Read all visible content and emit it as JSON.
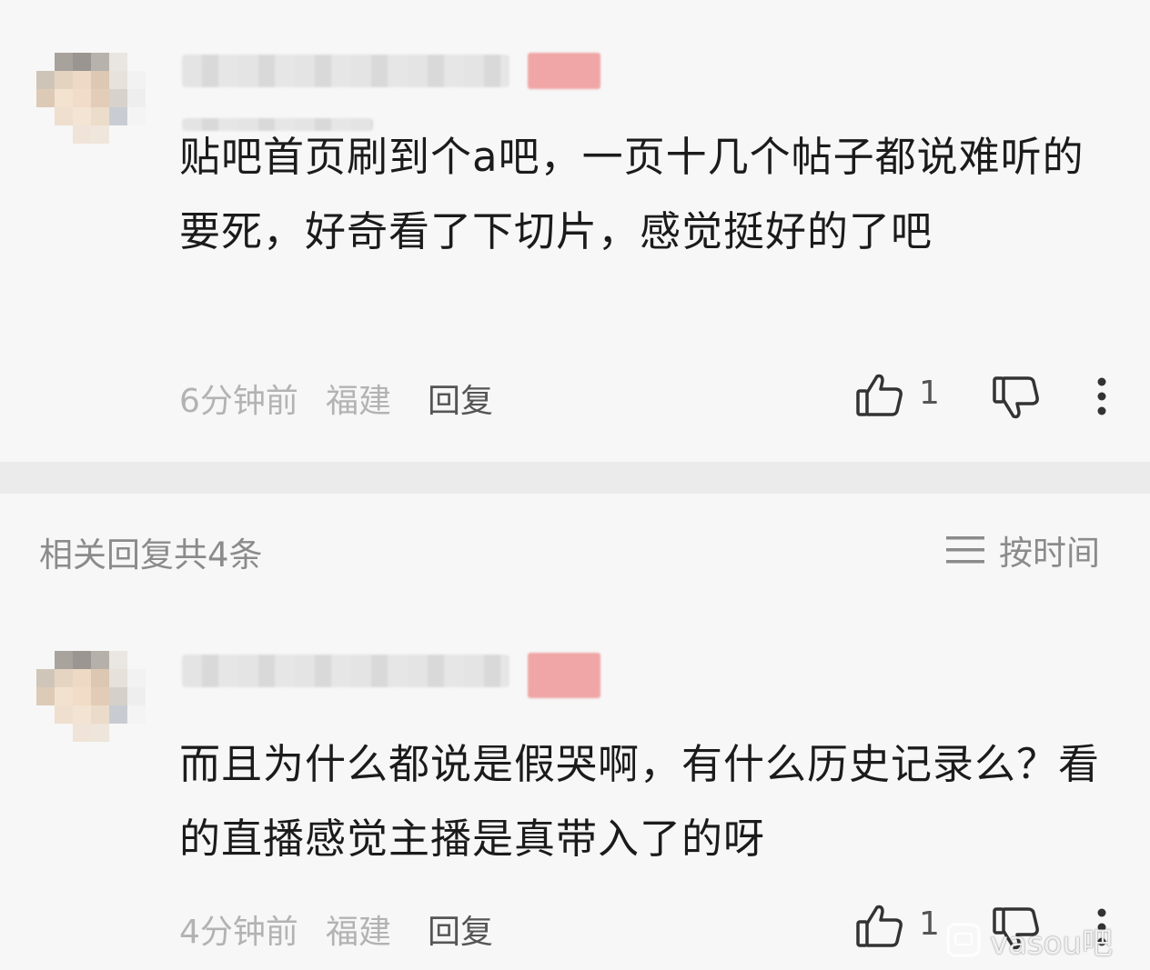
{
  "comments": [
    {
      "text": "贴吧首页刷到个a吧，一页十几个帖子都说难听的要死，好奇看了下切片，感觉挺好的了吧",
      "time": "6分钟前",
      "location": "福建",
      "reply_label": "回复",
      "likes": "1"
    },
    {
      "text": "而且为什么都说是假哭啊，有什么历史记录么？看的直播感觉主播是真带入了的呀",
      "time": "4分钟前",
      "location": "福建",
      "reply_label": "回复",
      "likes": "1"
    }
  ],
  "section": {
    "title": "相关回复共4条",
    "sort_label": "按时间"
  },
  "watermark": "vasou吧",
  "icons": {
    "like": "thumb-up-icon",
    "dislike": "thumb-down-icon",
    "more": "more-vertical-icon",
    "sort": "sort-lines-icon"
  }
}
